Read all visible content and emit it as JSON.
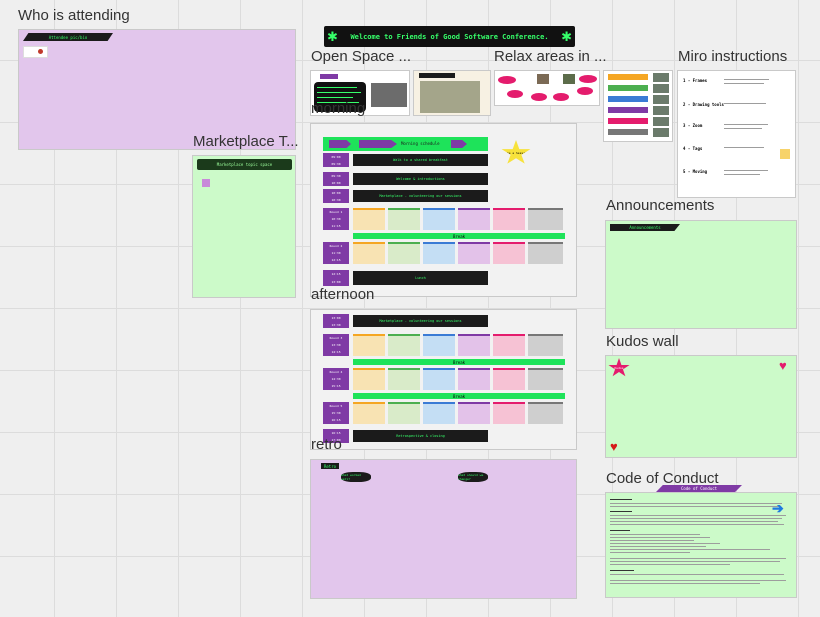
{
  "frames": {
    "attending": {
      "title": "Who is attending",
      "header": "Attendee pic/bio"
    },
    "marketplace": {
      "title": "Marketplace T...",
      "header": "Marketplace topic space"
    },
    "welcome": {
      "banner": "Welcome to Friends of Good Software Conference."
    },
    "open_space": {
      "title": "Open Space ..."
    },
    "relax": {
      "title": "Relax areas in ..."
    },
    "miro": {
      "title": "Miro instructions",
      "sections": [
        "1 - Frames",
        "2 - Drawing tools",
        "3 - Zoom",
        "4 - Tags",
        "5 - Moving"
      ]
    },
    "morning": {
      "title": "morning",
      "header": "Morning schedule",
      "star_note": "Make a Session",
      "sessions": [
        "Walk to a shared breakfast",
        "Welcome & introductions",
        "Marketplace - volunteering our sessions",
        "Break",
        "Lunch"
      ],
      "times": [
        [
          "09:00",
          "09:30"
        ],
        [
          "09:30",
          "10:00"
        ],
        [
          "10:00",
          "10:30"
        ],
        [
          "Round 1",
          "10:30",
          "11:15"
        ],
        [
          "Round 2",
          "11:30",
          "12:15"
        ],
        [
          "12:15",
          "13:00"
        ]
      ]
    },
    "afternoon": {
      "title": "afternoon",
      "sessions": [
        "Marketplace - volunteering our sessions",
        "Break",
        "Break",
        "Retrospective & closing"
      ],
      "times": [
        [
          "13:00",
          "13:30"
        ],
        [
          "Round 3",
          "13:30",
          "14:15"
        ],
        [
          "Round 4",
          "14:30",
          "15:15"
        ],
        [
          "Round 5",
          "15:30",
          "16:15"
        ],
        [
          "16:15",
          "17:00"
        ]
      ]
    },
    "retro": {
      "title": "retro",
      "tag": "Retro",
      "bubbles": [
        "what worked well?",
        "what should we change?"
      ]
    },
    "announcements": {
      "title": "Announcements",
      "header": "Announcements"
    },
    "kudos": {
      "title": "Kudos wall",
      "star": "Kudos"
    },
    "coc": {
      "title": "Code of Conduct",
      "header": "Code of Conduct"
    }
  },
  "colors": {
    "purple_frame": "#e2c6ec",
    "green_frame": "#ccfac9",
    "accent_purple": "#7f3aa5",
    "accent_green": "#1ee35a",
    "dark": "#1b1b1b"
  },
  "icons": [
    "star-icon",
    "heart-icon",
    "arrow-right-icon"
  ]
}
